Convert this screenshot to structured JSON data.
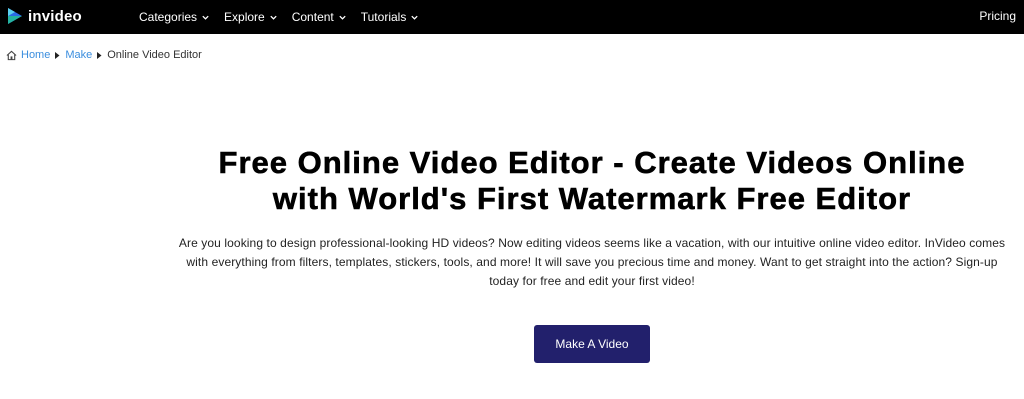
{
  "header": {
    "logo_text": "invideo",
    "nav": [
      {
        "label": "Categories"
      },
      {
        "label": "Explore"
      },
      {
        "label": "Content"
      },
      {
        "label": "Tutorials"
      }
    ],
    "pricing_label": "Pricing"
  },
  "breadcrumb": {
    "items": [
      {
        "label": "Home"
      },
      {
        "label": "Make"
      }
    ],
    "current": "Online Video Editor"
  },
  "main": {
    "title_line1": "Free Online Video Editor - Create Videos Online",
    "title_line2": "with World's First Watermark Free Editor",
    "description": "Are you looking to design professional-looking HD videos? Now editing videos seems like a vacation, with our intuitive online video editor. InVideo comes with everything from filters, templates, stickers, tools, and more! It will save you precious time and money. Want to get straight into the action? Sign-up today for free and edit your first video!",
    "cta_label": "Make A Video"
  },
  "colors": {
    "topbar_bg": "#000000",
    "link": "#3b8ede",
    "cta_bg": "#22206c"
  },
  "icons": [
    "invideo-logo-icon",
    "chevron-down-icon",
    "home-icon",
    "chevron-right-icon"
  ]
}
